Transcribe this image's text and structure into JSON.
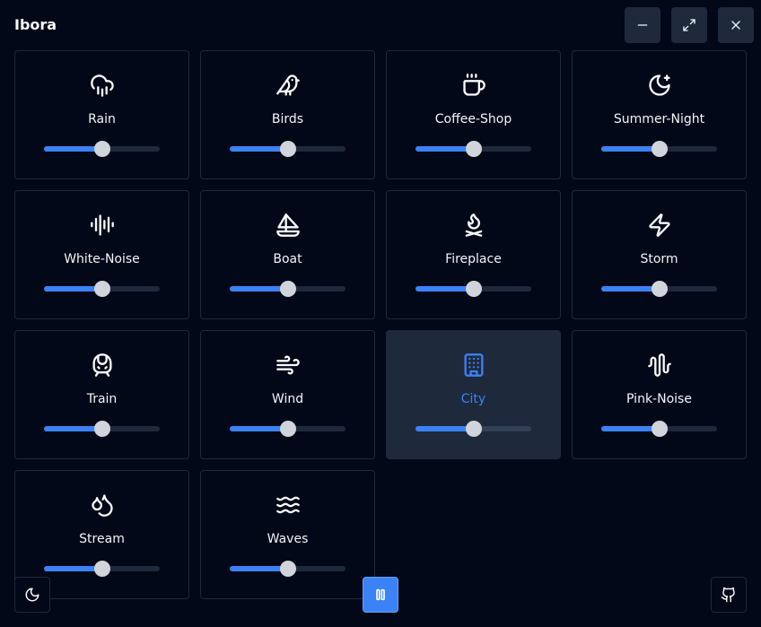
{
  "app": {
    "title": "Ibora"
  },
  "window": {
    "minimize_icon": "minus-icon",
    "maximize_icon": "maximize-icon",
    "close_icon": "close-icon"
  },
  "theme": {
    "accent": "#3b82f6",
    "background": "#020817",
    "card_border": "#1e293b",
    "active_card": "#1e293b"
  },
  "sounds": [
    {
      "label": "Rain",
      "icon": "cloud-rain-icon",
      "volume": 0.5,
      "active": false
    },
    {
      "label": "Birds",
      "icon": "bird-icon",
      "volume": 0.5,
      "active": false
    },
    {
      "label": "Coffee-Shop",
      "icon": "coffee-icon",
      "volume": 0.5,
      "active": false
    },
    {
      "label": "Summer-Night",
      "icon": "moon-star-icon",
      "volume": 0.5,
      "active": false
    },
    {
      "label": "White-Noise",
      "icon": "audio-lines-icon",
      "volume": 0.5,
      "active": false
    },
    {
      "label": "Boat",
      "icon": "sailboat-icon",
      "volume": 0.5,
      "active": false
    },
    {
      "label": "Fireplace",
      "icon": "flame-kindling-icon",
      "volume": 0.5,
      "active": false
    },
    {
      "label": "Storm",
      "icon": "zap-icon",
      "volume": 0.5,
      "active": false
    },
    {
      "label": "Train",
      "icon": "train-front-icon",
      "volume": 0.5,
      "active": false
    },
    {
      "label": "Wind",
      "icon": "wind-icon",
      "volume": 0.5,
      "active": false
    },
    {
      "label": "City",
      "icon": "building-icon",
      "volume": 0.5,
      "active": true
    },
    {
      "label": "Pink-Noise",
      "icon": "audio-waveform-icon",
      "volume": 0.5,
      "active": false
    },
    {
      "label": "Stream",
      "icon": "droplets-icon",
      "volume": 0.5,
      "active": false
    },
    {
      "label": "Waves",
      "icon": "waves-icon",
      "volume": 0.5,
      "active": false
    }
  ],
  "footer": {
    "theme_icon": "moon-icon",
    "play_icon": "pause-icon",
    "github_icon": "github-icon"
  }
}
